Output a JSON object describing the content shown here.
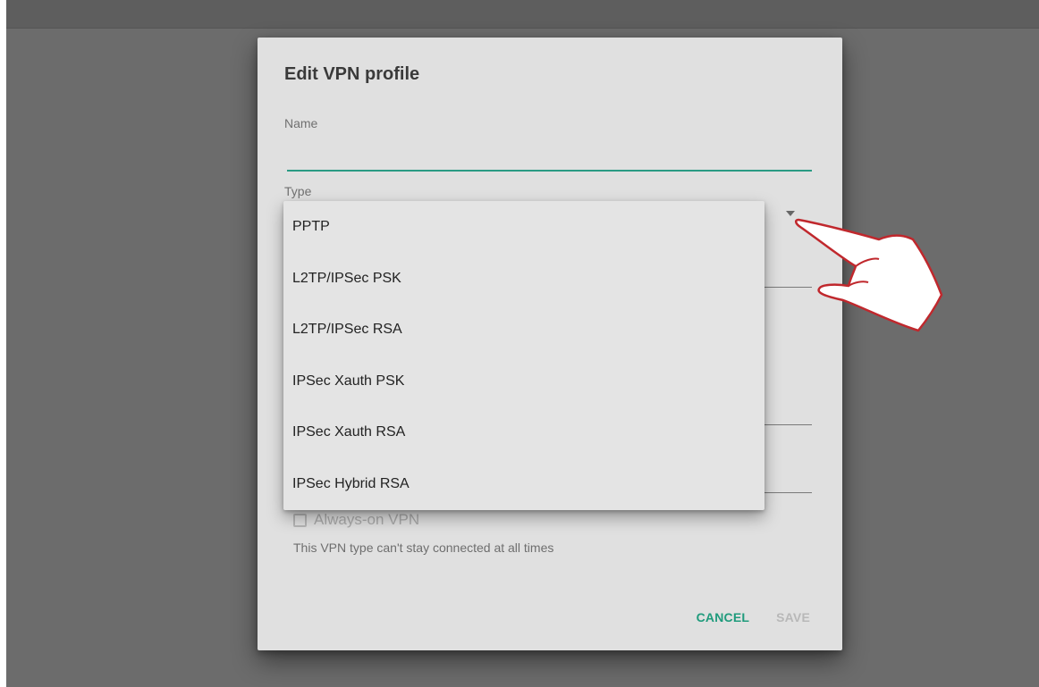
{
  "dialog": {
    "title": "Edit VPN profile",
    "name_label": "Name",
    "name_value": "",
    "type_label": "Type",
    "type_options": [
      "PPTP",
      "L2TP/IPSec PSK",
      "L2TP/IPSec RSA",
      "IPSec Xauth PSK",
      "IPSec Xauth RSA",
      "IPSec Hybrid RSA"
    ],
    "always_on_label": "Always-on VPN",
    "always_on_checked": false,
    "helper_text": "This VPN type can't stay connected at all times",
    "cancel_label": "CANCEL",
    "save_label": "SAVE"
  },
  "colors": {
    "accent": "#1f9b7c",
    "overlay": "#6c6c6c",
    "dialog_bg": "#e0e0e0",
    "hand_outline": "#c0282d"
  },
  "icons": {
    "dropdown": "triangle-down-icon",
    "pointer": "pointing-hand-icon"
  }
}
